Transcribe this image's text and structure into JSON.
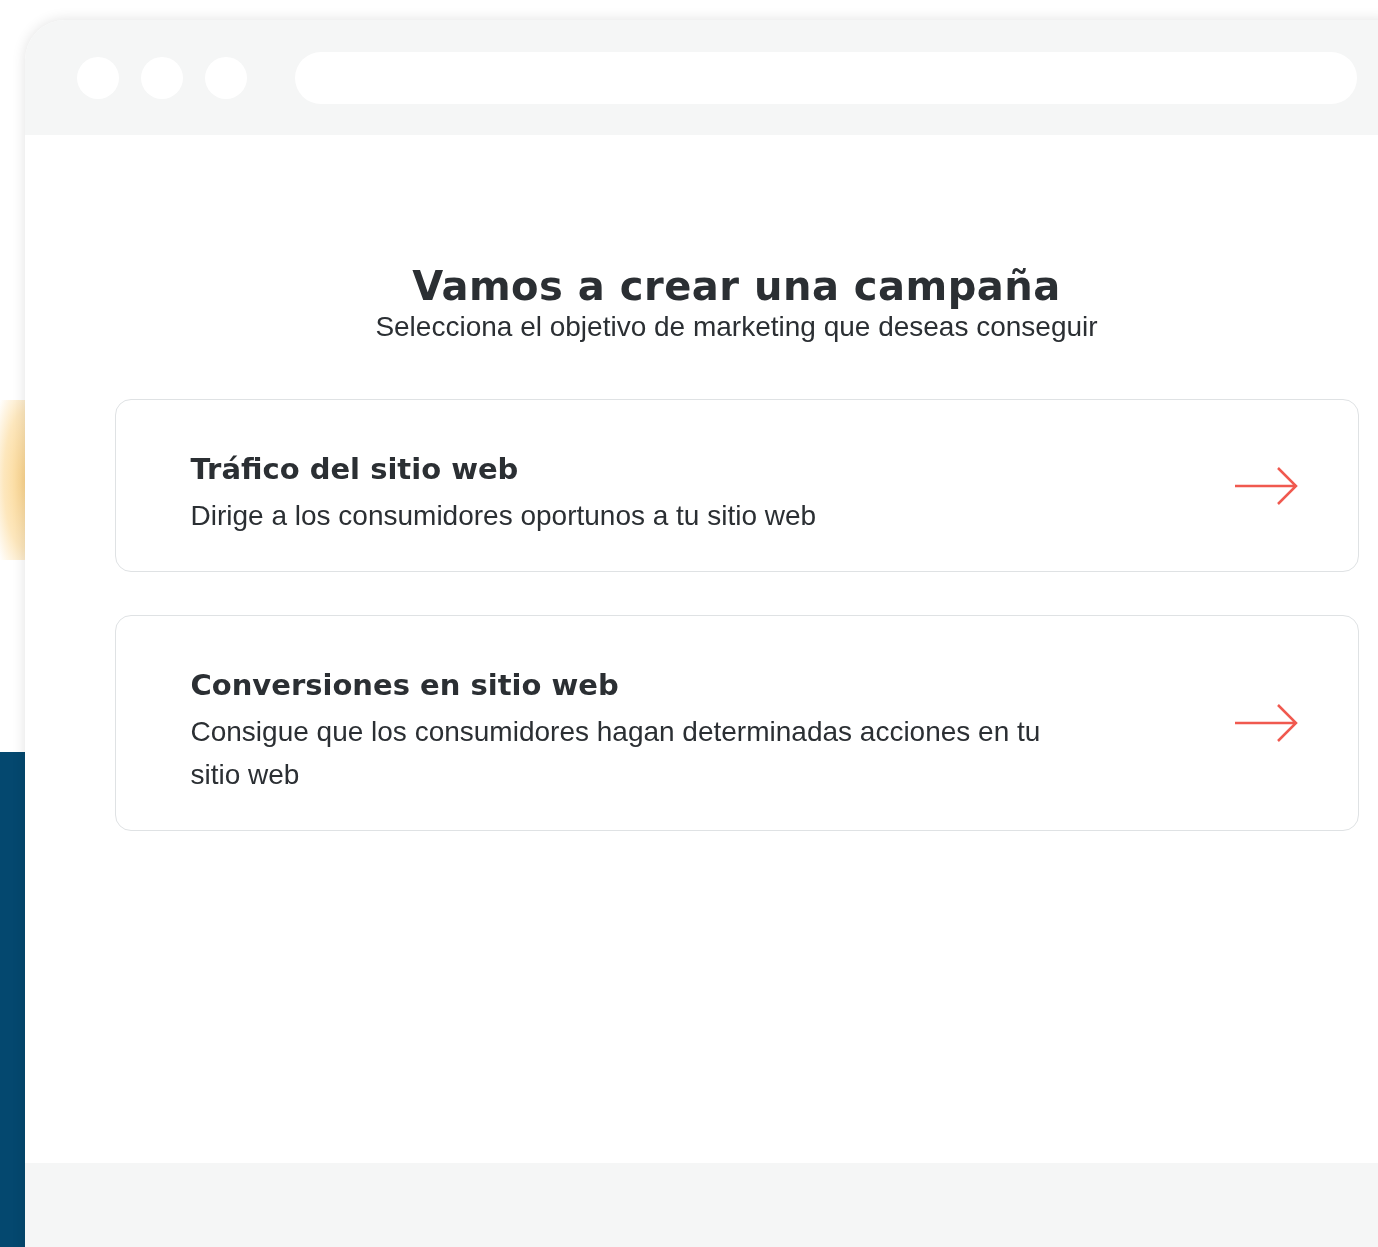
{
  "heading": {
    "title": "Vamos a crear una campaña",
    "subtitle": "Selecciona el objetivo de marketing que deseas conseguir"
  },
  "objectives": [
    {
      "title": "Tráfico del sitio web",
      "description": "Dirige a los consumidores oportunos a tu sitio web"
    },
    {
      "title": "Conversiones en sitio web",
      "description": "Consigue que los consumidores hagan determinadas acciones en tu sitio web"
    }
  ]
}
